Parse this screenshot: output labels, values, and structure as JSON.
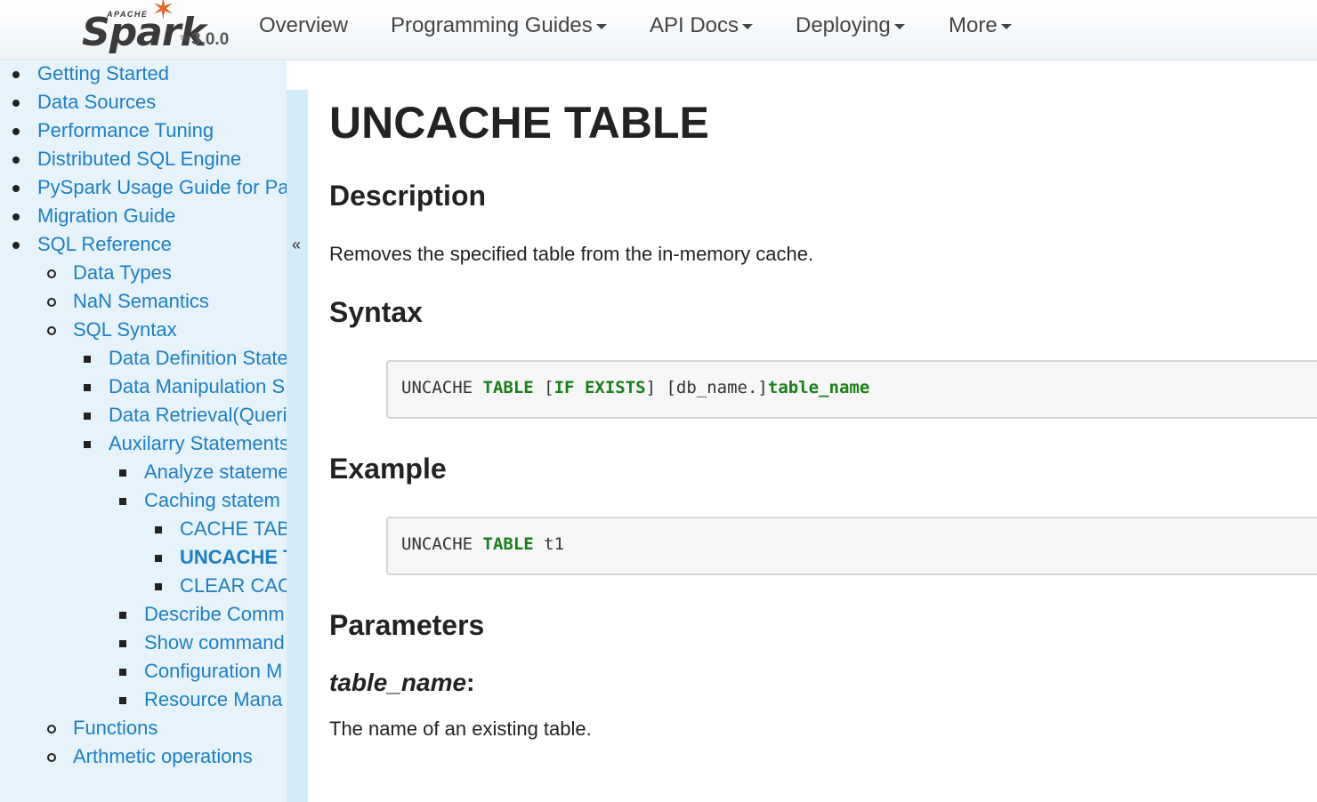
{
  "navbar": {
    "logo": {
      "apache": "APACHE",
      "spark": "Spark",
      "tm": "TM",
      "version": "3.0.0"
    },
    "items": [
      {
        "label": "Overview",
        "dropdown": false
      },
      {
        "label": "Programming Guides",
        "dropdown": true
      },
      {
        "label": "API Docs",
        "dropdown": true
      },
      {
        "label": "Deploying",
        "dropdown": true
      },
      {
        "label": "More",
        "dropdown": true
      }
    ]
  },
  "sidebar": {
    "collapse_label": "«",
    "items": [
      {
        "label": "Getting Started"
      },
      {
        "label": "Data Sources"
      },
      {
        "label": "Performance Tuning"
      },
      {
        "label": "Distributed SQL Engine"
      },
      {
        "label": "PySpark Usage Guide for Pa"
      },
      {
        "label": "Migration Guide"
      },
      {
        "label": "SQL Reference"
      },
      {
        "label": "Data Types"
      },
      {
        "label": "NaN Semantics"
      },
      {
        "label": "SQL Syntax"
      },
      {
        "label": "Data Definition State"
      },
      {
        "label": "Data Manipulation S"
      },
      {
        "label": "Data Retrieval(Queri"
      },
      {
        "label": "Auxilarry Statements"
      },
      {
        "label": "Analyze stateme"
      },
      {
        "label": "Caching statem"
      },
      {
        "label": "CACHE TAB"
      },
      {
        "label": "UNCACHE T",
        "active": true
      },
      {
        "label": "CLEAR CAC"
      },
      {
        "label": "Describe Comm"
      },
      {
        "label": "Show command"
      },
      {
        "label": "Configuration M"
      },
      {
        "label": "Resource Mana"
      },
      {
        "label": "Functions"
      },
      {
        "label": "Arthmetic operations"
      }
    ]
  },
  "content": {
    "title": "UNCACHE TABLE",
    "description_heading": "Description",
    "description_text": "Removes the specified table from the in-memory cache.",
    "syntax_heading": "Syntax",
    "syntax_code": {
      "t1": "UNCACHE ",
      "k1": "TABLE",
      "t2": " [",
      "k2": "IF",
      "t3": " ",
      "k3": "EXISTS",
      "t4": "] [db_name.]",
      "k4": "table_name"
    },
    "example_heading": "Example",
    "example_code": {
      "t1": "UNCACHE ",
      "k1": "TABLE",
      "t2": " t1"
    },
    "parameters_heading": "Parameters",
    "param_name": "table_name",
    "param_colon": ":",
    "param_desc": "The name of an existing table."
  }
}
